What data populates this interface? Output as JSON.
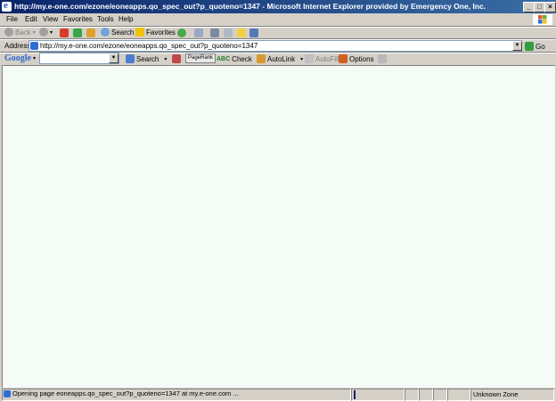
{
  "window": {
    "title": "http://my.e-one.com/ezone/eoneapps.qo_spec_out?p_quoteno=1347 - Microsoft Internet Explorer provided by Emergency One, Inc."
  },
  "menu": [
    "File",
    "Edit",
    "View",
    "Favorites",
    "Tools",
    "Help"
  ],
  "toolbar": {
    "back": "Back",
    "search": "Search",
    "favorites": "Favorites"
  },
  "address": {
    "label": "Address",
    "url": "http://my.e-one.com/ezone/eoneapps.qo_spec_out?p_quoteno=1347",
    "go": "Go"
  },
  "google": {
    "logo": "Google",
    "search": "Search",
    "pagerank": "PageRank",
    "check": "Check",
    "autolink": "AutoLink",
    "autofill": "AutoFill",
    "options": "Options"
  },
  "status": {
    "text": "Opening page eoneapps.qo_spec_out?p_quoteno=1347 at my.e-one.com ...",
    "zone": "Unknown Zone"
  },
  "colors": {
    "title_bar": "#0a246a",
    "content_bg": "#f5fbf7",
    "chrome": "#d4d0c8"
  }
}
